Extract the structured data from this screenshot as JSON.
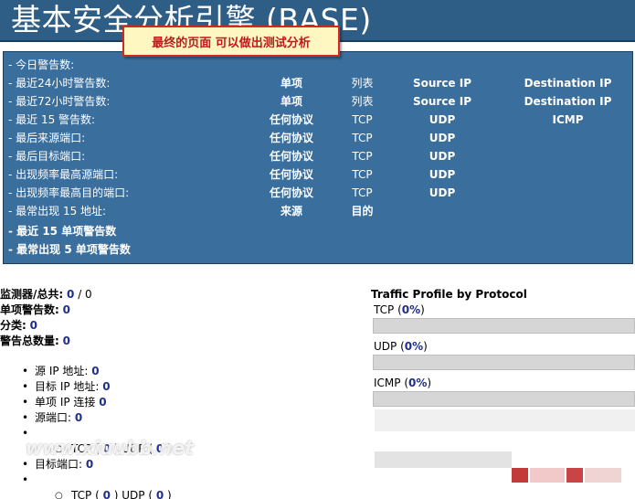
{
  "header": {
    "title": "基本安全分析引擎 (BASE)"
  },
  "callout": "最终的页面  可以做出测试分析",
  "panel": {
    "rows": [
      {
        "label": "- 今日警告数:",
        "c1": "",
        "c2": "",
        "c3": "",
        "c4": ""
      },
      {
        "label": "- 最近24小时警告数:",
        "c1": "单项",
        "c2": "列表",
        "c3": "Source IP",
        "c4": "Destination IP"
      },
      {
        "label": "- 最近72小时警告数:",
        "c1": "单项",
        "c2": "列表",
        "c3": "Source IP",
        "c4": "Destination IP"
      },
      {
        "label": "- 最近  15 警告数:",
        "c1": "任何协议",
        "c2": "TCP",
        "c3": "UDP",
        "c4": "ICMP"
      },
      {
        "label": "- 最后来源端口:",
        "c1": "任何协议",
        "c2": "TCP",
        "c3": "UDP",
        "c4": ""
      },
      {
        "label": "- 最后目标端口:",
        "c1": "任何协议",
        "c2": "TCP",
        "c3": "UDP",
        "c4": ""
      },
      {
        "label": "- 出现频率最高源端口:",
        "c1": "任何协议",
        "c2": "TCP",
        "c3": "UDP",
        "c4": ""
      },
      {
        "label": "- 出现频率最高目的端口:",
        "c1": "任何协议",
        "c2": "TCP",
        "c3": "UDP",
        "c4": ""
      },
      {
        "label": "- 最常出现  15 地址:",
        "c1": "来源",
        "c2": "目的",
        "c3": "",
        "c4": ""
      }
    ],
    "bold_rows": [
      "- 最近  15 单项警告数",
      "- 最常出现  5 单项警告数"
    ]
  },
  "stats": {
    "sensors_label": "监测器/总共:",
    "sensors_value": "0",
    "sensors_sep": " / ",
    "sensors_total": "0",
    "unique_label": "单项警告数:",
    "unique_value": "0",
    "category_label": "分类:",
    "category_value": "0",
    "total_label": "警告总数量:",
    "total_value": "0"
  },
  "addresses": {
    "src_ip_label": "源  IP 地址:",
    "src_ip_value": "0",
    "dst_ip_label": "目标  IP 地址:",
    "dst_ip_value": "0",
    "unique_ip_label": "单项  IP 连接",
    "unique_ip_value": "0",
    "src_port_label": "源端口:",
    "src_port_value": "0",
    "dst_port_label": "目标端口:",
    "dst_port_value": "0",
    "tcp_label": "TCP",
    "tcp_value": "0",
    "udp_label": "UDP",
    "udp_value": "0"
  },
  "traffic": {
    "title": "Traffic Profile by Protocol",
    "protocols": [
      {
        "name": "TCP",
        "pct": "0%",
        "fill": 0
      },
      {
        "name": "UDP",
        "pct": "0%",
        "fill": 0
      },
      {
        "name": "ICMP",
        "pct": "0%",
        "fill": 0
      }
    ]
  },
  "watermark": "www.xiuubb.net"
}
